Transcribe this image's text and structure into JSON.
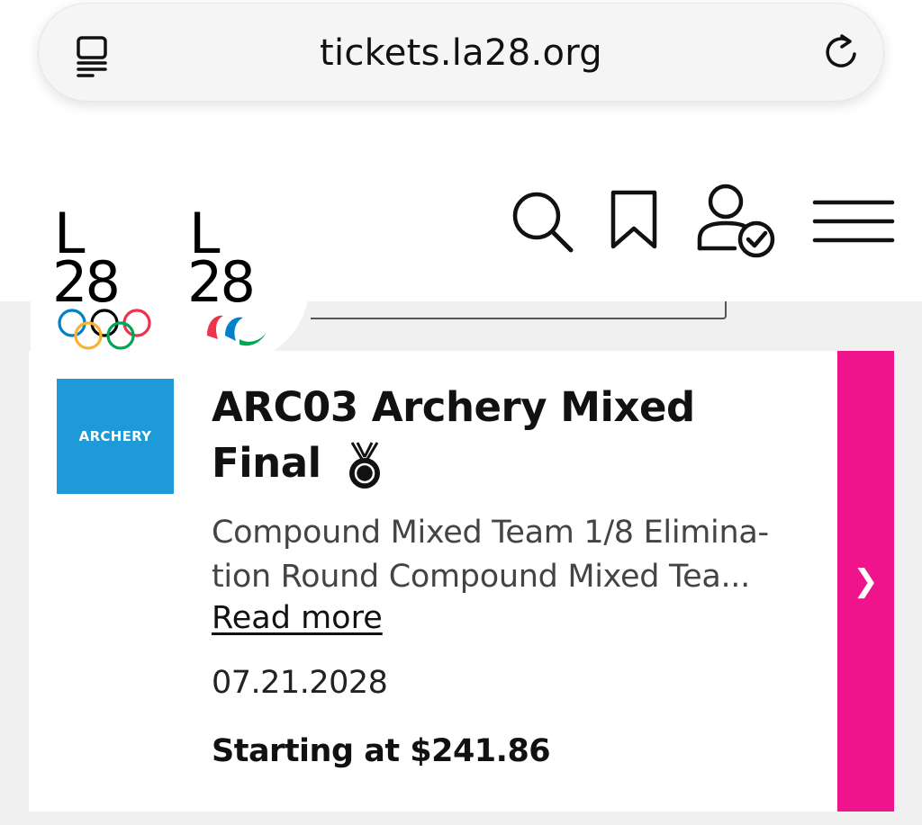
{
  "browser": {
    "url": "tickets.la28.org"
  },
  "logo": {
    "olympic_top": "L",
    "olympic_bottom": "28",
    "paralympic_top": "L",
    "paralympic_bottom": "28"
  },
  "header_icons": [
    "search-icon",
    "bookmark-icon",
    "account-check-icon",
    "menu-icon"
  ],
  "event": {
    "sport_label": "ARCHERY",
    "title": "ARC03 Archery Mixed Final",
    "description": "Compound Mixed Team 1/8 Elimina-tion Round Compound Mixed Tea...",
    "read_more": "Read more",
    "date": "07.21.2028",
    "price": "Starting at $241.86",
    "arrow": "❯"
  },
  "colors": {
    "sport_tile": "#1f9ad8",
    "accent_pink": "#f0148c"
  }
}
